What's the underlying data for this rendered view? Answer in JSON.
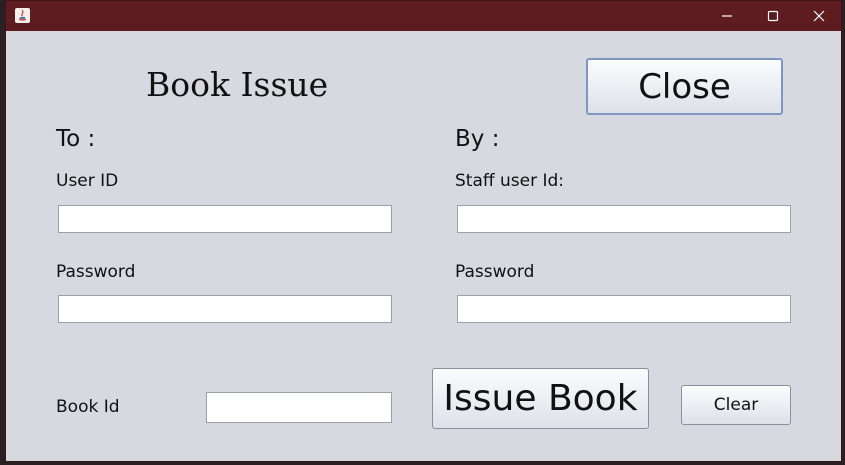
{
  "window": {
    "title": "",
    "controls": {
      "minimize_icon": "minimize-icon",
      "maximize_icon": "maximize-icon",
      "close_icon": "close-icon"
    },
    "colors": {
      "titlebar": "#5e1b20",
      "background": "#d7d9e0"
    }
  },
  "form": {
    "heading": "Book Issue",
    "close_label": "Close",
    "to_label": "To :",
    "by_label": "By :",
    "user_id_label": "User ID",
    "user_password_label": "Password",
    "staff_id_label": "Staff user Id:",
    "staff_password_label": "Password",
    "book_id_label": "Book Id",
    "user_id_value": "",
    "user_password_value": "",
    "staff_id_value": "",
    "staff_password_value": "",
    "book_id_value": "",
    "issue_label": "Issue Book",
    "clear_label": "Clear"
  }
}
